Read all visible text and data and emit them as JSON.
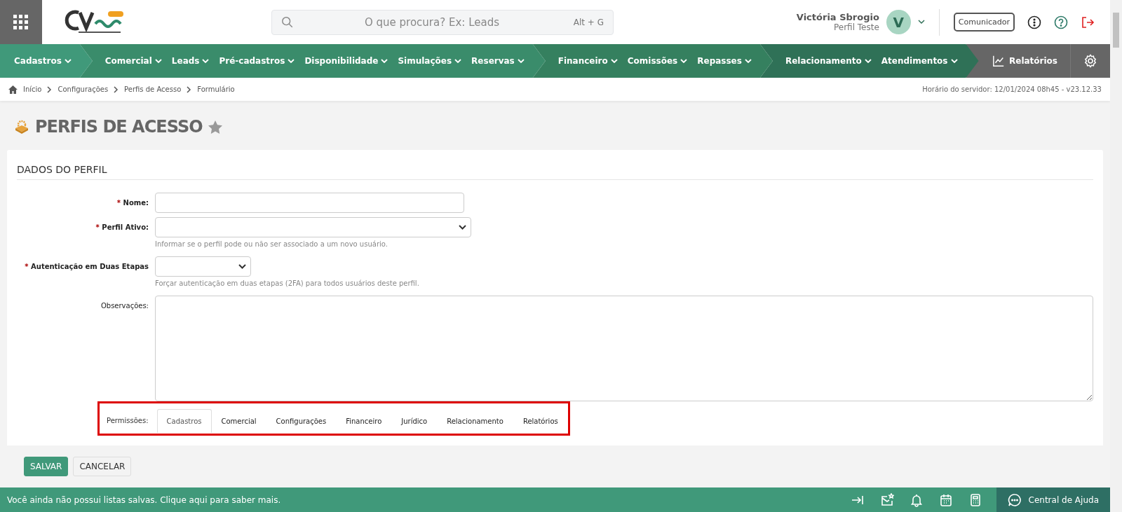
{
  "header": {
    "search": {
      "placeholder": "O que procura? Ex: Leads",
      "shortcut": "Alt + G"
    },
    "user": {
      "name": "Victória Sbrogio",
      "profile": "Perfil Teste",
      "initial": "V"
    },
    "communicator_button": "Comunicador"
  },
  "nav": {
    "groups": [
      {
        "items": [
          "Cadastros"
        ]
      },
      {
        "items": [
          "Comercial",
          "Leads",
          "Pré-cadastros",
          "Disponibilidade",
          "Simulações",
          "Reservas"
        ]
      },
      {
        "items": [
          "Financeiro",
          "Comissões",
          "Repasses"
        ]
      },
      {
        "items": [
          "Relacionamento",
          "Atendimentos"
        ]
      }
    ],
    "reports": "Relatórios"
  },
  "breadcrumb": [
    "Início",
    "Configurações",
    "Perfis de Acesso",
    "Formulário"
  ],
  "server_time": "Horário do servidor: 12/01/2024 08h45 - v23.12.33",
  "page_title": "PERFIS DE ACESSO",
  "section_title": "DADOS DO PERFIL",
  "fields": [
    {
      "kind": "text",
      "label": "Nome:",
      "required_mark": "*"
    },
    {
      "kind": "select",
      "label": "Perfil Ativo:",
      "required_mark": "*",
      "help": "Informar se o perfil pode ou não ser associado a um novo usuário."
    },
    {
      "kind": "select-small",
      "label": "Autenticação em Duas Etapas",
      "required_mark": "*",
      "help": "Forçar autenticação em duas etapas (2FA) para todos usuários deste perfil."
    },
    {
      "kind": "textarea",
      "label": "Observações:"
    }
  ],
  "permissions": {
    "label": "Permissões:",
    "tabs": [
      {
        "label": "Cadastros",
        "selected": true
      },
      {
        "label": "Comercial",
        "selected": false
      },
      {
        "label": "Configurações",
        "selected": false
      },
      {
        "label": "Financeiro",
        "selected": false
      },
      {
        "label": "Jurídico",
        "selected": false
      },
      {
        "label": "Relacionamento",
        "selected": false
      },
      {
        "label": "Relatórios",
        "selected": false
      }
    ]
  },
  "buttons": {
    "save": "SALVAR",
    "cancel": "CANCELAR"
  },
  "status_bar": {
    "message": "Você ainda não possui listas salvas. Clique aqui para saber mais.",
    "help": "Central de Ajuda"
  }
}
